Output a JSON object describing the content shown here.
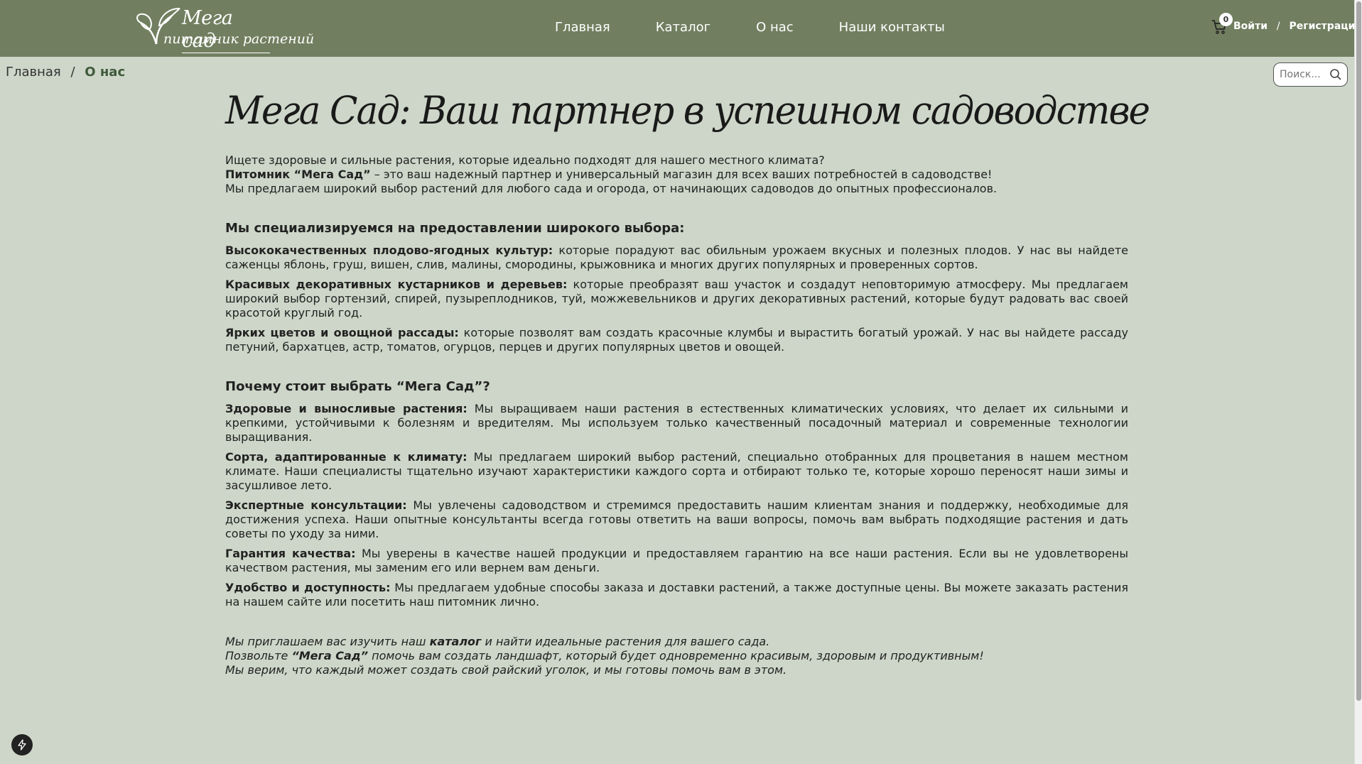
{
  "header": {
    "logo_title": "Мега сад",
    "logo_subtitle": "питомник растений",
    "nav": [
      {
        "label": "Главная"
      },
      {
        "label": "Каталог"
      },
      {
        "label": "О нас"
      },
      {
        "label": "Наши контакты"
      }
    ],
    "cart_count": "0",
    "login_label": "Войти",
    "auth_separator": "/",
    "register_label": "Регистрация",
    "colors": {
      "header_bg": "#717f60",
      "page_bg": "#cdd6c8"
    }
  },
  "breadcrumb": {
    "home": "Главная",
    "separator": "/",
    "current": "О нас"
  },
  "search": {
    "placeholder": "Поиск...",
    "icon": "search-icon"
  },
  "content": {
    "title": "Мега Сад: Ваш партнер в успешном садоводстве",
    "intro": {
      "line1": "Ищете здоровые и сильные растения, которые идеально подходят для нашего местного климата?",
      "line2_bold": "Питомник “Мега Сад”",
      "line2_rest": " – это ваш надежный партнер и универсальный магазин для всех ваших потребностей в садоводстве!",
      "line3": "Мы предлагаем широкий выбор растений для любого сада и огорода, от начинающих садоводов до опытных профессионалов."
    },
    "specialize": {
      "heading": "Мы специализируемся на предоставлении широкого выбора:",
      "items": [
        {
          "bold": "Высококачественных плодово-ягодных культур:",
          "text": " которые порадуют вас обильным урожаем вкусных и полезных плодов. У нас вы найдете саженцы яблонь, груш, вишен, слив, малины, смородины, крыжовника и многих других популярных и проверенных сортов."
        },
        {
          "bold": "Красивых декоративных кустарников и деревьев:",
          "text": " которые преобразят ваш участок и создадут неповторимую атмосферу. Мы предлагаем широкий выбор гортензий, спирей, пузыреплодников, туй, можжевельников и других декоративных растений, которые будут радовать вас своей красотой круглый год."
        },
        {
          "bold": "Ярких цветов и овощной рассады:",
          "text": " которые позволят вам создать красочные клумбы и вырастить богатый урожай. У нас вы найдете рассаду петуний, бархатцев, астр, томатов, огурцов, перцев и других популярных цветов и овощей."
        }
      ]
    },
    "why": {
      "heading": "Почему стоит выбрать “Мега Сад”?",
      "items": [
        {
          "bold": "Здоровые и выносливые растения:",
          "text": " Мы выращиваем наши растения в естественных климатических условиях, что делает их сильными и крепкими, устойчивыми к болезням и вредителям. Мы используем только качественный посадочный материал и современные технологии выращивания."
        },
        {
          "bold": "Сорта, адаптированные к климату:",
          "text": " Мы предлагаем широкий выбор растений, специально отобранных для процветания в нашем местном климате. Наши специалисты тщательно изучают характеристики каждого сорта и отбирают только те, которые хорошо переносят наши зимы и засушливое лето."
        },
        {
          "bold": "Экспертные консультации:",
          "text": " Мы увлечены садоводством и стремимся предоставить нашим клиентам знания и поддержку, необходимые для достижения успеха. Наши опытные консультанты всегда готовы ответить на ваши вопросы, помочь вам выбрать подходящие растения и дать советы по уходу за ними."
        },
        {
          "bold": "Гарантия качества:",
          "text": " Мы уверены в качестве нашей продукции и предоставляем гарантию на все наши растения. Если вы не удовлетворены качеством растения, мы заменим его или вернем вам деньги."
        },
        {
          "bold": "Удобство и доступность:",
          "text": " Мы предлагаем удобные способы заказа и доставки растений, а также доступные цены. Вы можете заказать растения на нашем сайте или посетить наш питомник лично."
        }
      ]
    },
    "closing": {
      "l1_pre": "Мы приглашаем вас изучить наш ",
      "l1_link": "каталог",
      "l1_post": " и найти идеальные растения для вашего сада.",
      "l2_pre": "Позвольте ",
      "l2_bold": "“Мега Сад”",
      "l2_post": " помочь вам создать ландшафт, который будет одновременно красивым, здоровым и продуктивным!",
      "l3": "Мы верим, что каждый может создать свой райский уголок, и мы готовы помочь вам в этом."
    }
  }
}
